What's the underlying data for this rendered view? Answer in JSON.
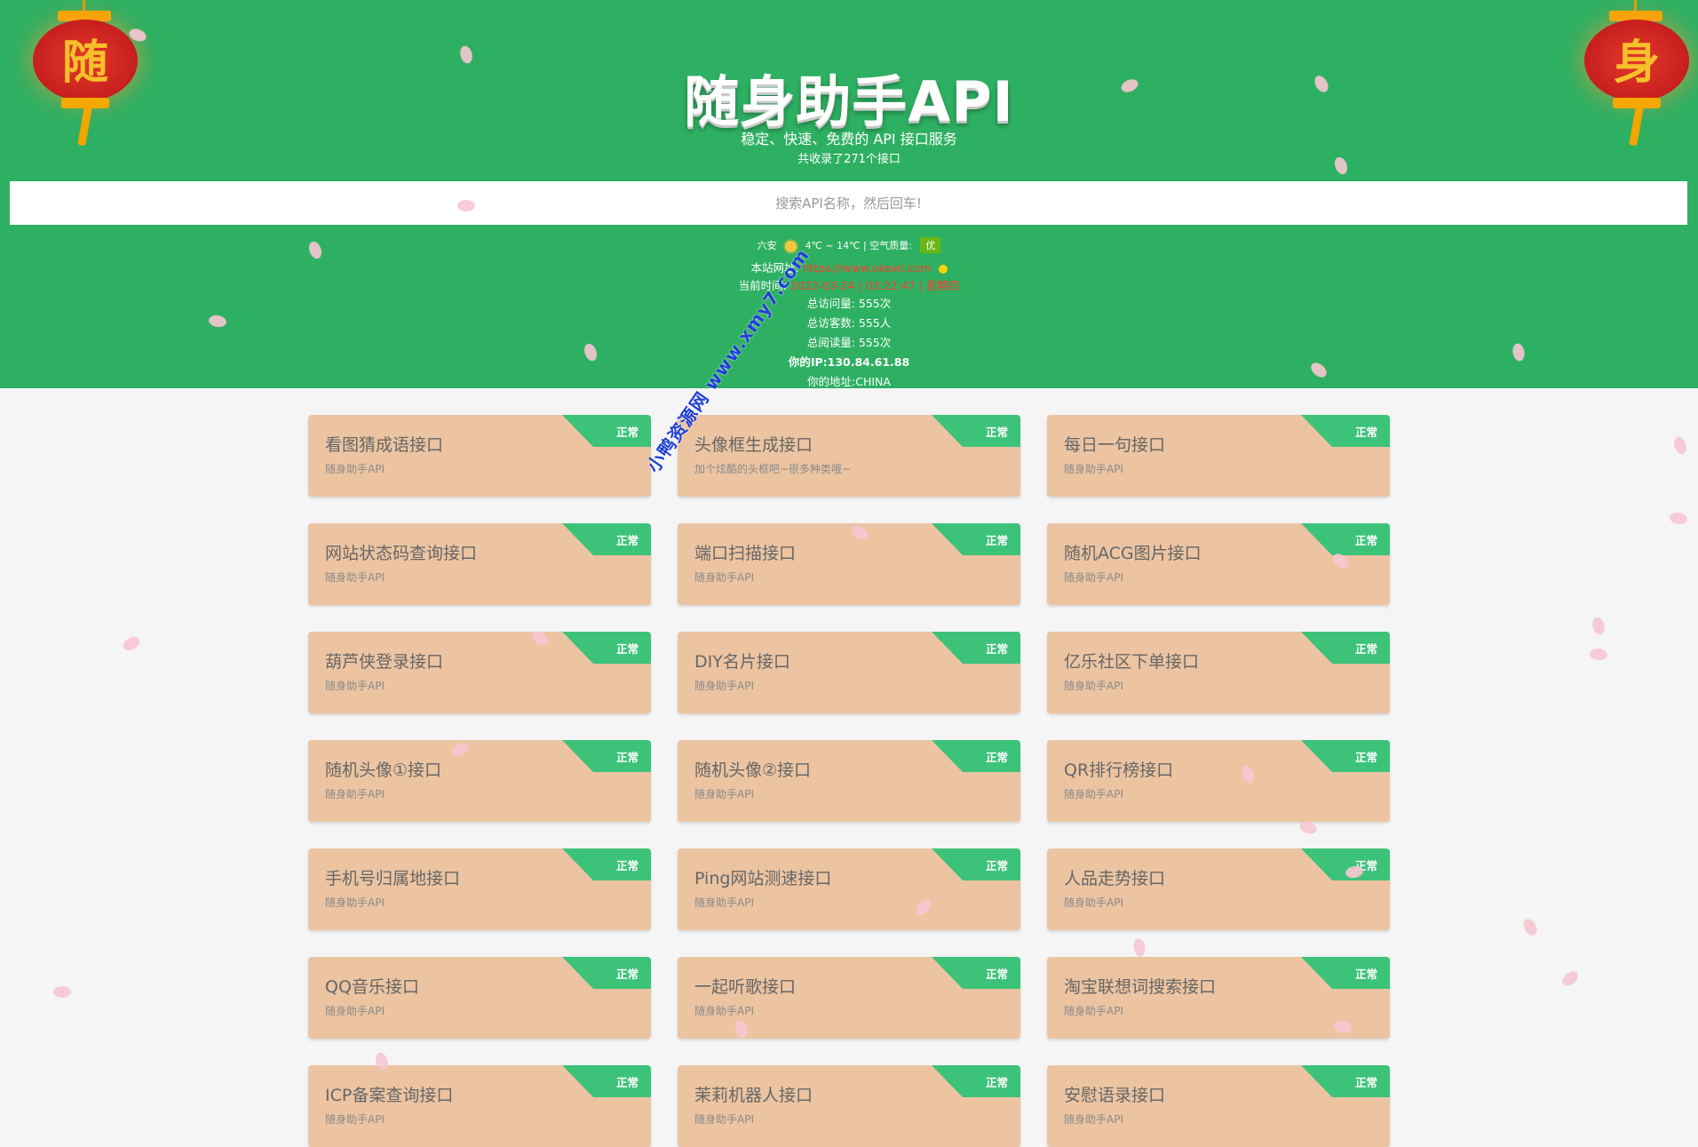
{
  "header": {
    "title": "随身助手API",
    "subtitle": "稳定、快速、免费的 API 接口服务",
    "count": "共收录了271个接口",
    "search_placeholder": "搜索API名称，然后回车!",
    "lantern_left": "随",
    "lantern_right": "身"
  },
  "info": {
    "city": "六安",
    "temperature": "4℃ ~ 14℃",
    "separator": "|",
    "air_label": "空气质量:",
    "air_value": "优",
    "site_label": "本站网址:",
    "site_url": "https://www.okewl.com",
    "time_label": "当前时间:",
    "time_value": "2022-03-24 | 03:22:47 | 星期四",
    "visits": "总访问量: 555次",
    "visitors": "总访客数: 555人",
    "reads": "总阅读量: 555次",
    "ip": "你的IP:130.84.61.88",
    "address": "你的地址:CHINA"
  },
  "watermark": "小鸭资源网 www.xmy7.com",
  "cards": [
    {
      "title": "看图猜成语接口",
      "desc": "随身助手API",
      "status": "正常"
    },
    {
      "title": "头像框生成接口",
      "desc": "加个炫酷的头框吧~很多种类哦~",
      "status": "正常"
    },
    {
      "title": "每日一句接口",
      "desc": "随身助手API",
      "status": "正常"
    },
    {
      "title": "网站状态码查询接口",
      "desc": "随身助手API",
      "status": "正常"
    },
    {
      "title": "端口扫描接口",
      "desc": "随身助手API",
      "status": "正常"
    },
    {
      "title": "随机ACG图片接口",
      "desc": "随身助手API",
      "status": "正常"
    },
    {
      "title": "葫芦侠登录接口",
      "desc": "随身助手API",
      "status": "正常"
    },
    {
      "title": "DIY名片接口",
      "desc": "随身助手API",
      "status": "正常"
    },
    {
      "title": "亿乐社区下单接口",
      "desc": "随身助手API",
      "status": "正常"
    },
    {
      "title": "随机头像①接口",
      "desc": "随身助手API",
      "status": "正常"
    },
    {
      "title": "随机头像②接口",
      "desc": "随身助手API",
      "status": "正常"
    },
    {
      "title": "QR排行榜接口",
      "desc": "随身助手API",
      "status": "正常"
    },
    {
      "title": "手机号归属地接口",
      "desc": "随身助手API",
      "status": "正常"
    },
    {
      "title": "Ping网站测速接口",
      "desc": "随身助手API",
      "status": "正常"
    },
    {
      "title": "人品走势接口",
      "desc": "随身助手API",
      "status": "正常"
    },
    {
      "title": "QQ音乐接口",
      "desc": "随身助手API",
      "status": "正常"
    },
    {
      "title": "一起听歌接口",
      "desc": "随身助手API",
      "status": "正常"
    },
    {
      "title": "淘宝联想词搜索接口",
      "desc": "随身助手API",
      "status": "正常"
    },
    {
      "title": "ICP备案查询接口",
      "desc": "随身助手API",
      "status": "正常"
    },
    {
      "title": "茉莉机器人接口",
      "desc": "随身助手API",
      "status": "正常"
    },
    {
      "title": "安慰语录接口",
      "desc": "随身助手API",
      "status": "正常"
    }
  ],
  "colors": {
    "header_bg": "#2eb062",
    "card_bg": "#ecc4a2",
    "ribbon": "#3dc27a",
    "link_red": "#ff3b2f"
  }
}
